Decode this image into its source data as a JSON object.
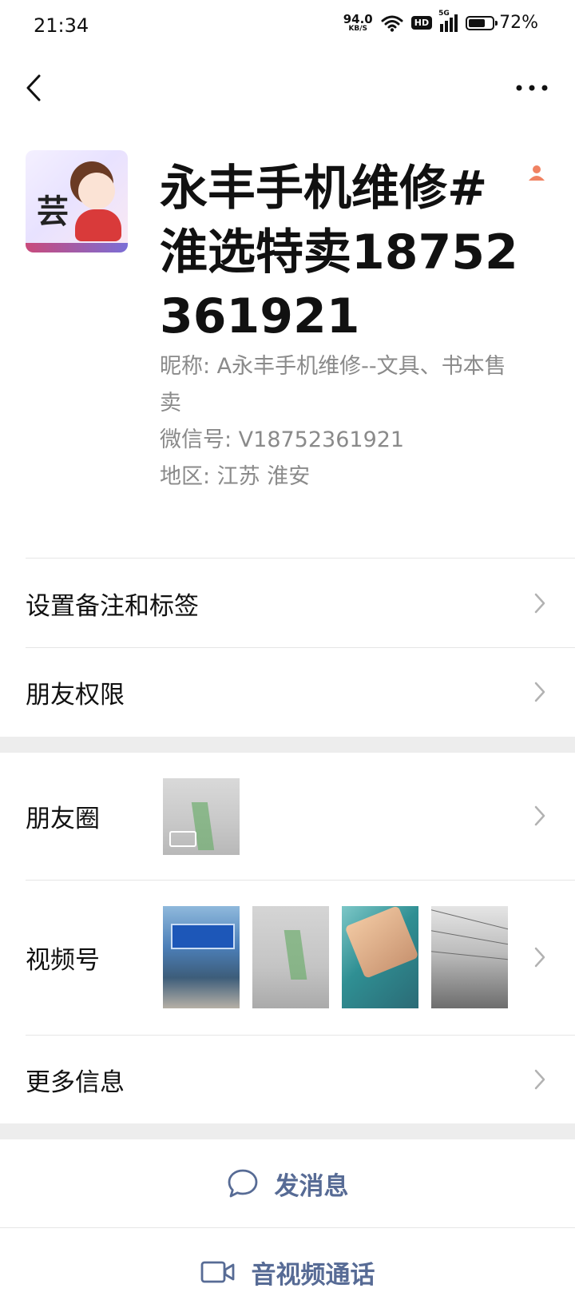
{
  "status_bar": {
    "time": "21:34",
    "net_speed_value": "94.0",
    "net_speed_unit": "KB/S",
    "hd_badge": "HD",
    "signal_tag": "5G",
    "battery_percent": "72%",
    "battery_level": 0.72
  },
  "profile": {
    "display_name": "永丰手机维修#淮选特卖18752361921",
    "avatar_char": "芸",
    "nickname": "昵称: A永丰手机维修--文具、书本售卖",
    "wechat_id": "微信号: V18752361921",
    "region": "地区: 江苏 淮安"
  },
  "menu": {
    "remark_tags": "设置备注和标签",
    "friend_permissions": "朋友权限",
    "moments": "朋友圈",
    "channels": "视频号",
    "more_info": "更多信息"
  },
  "actions": {
    "send_message": "发消息",
    "av_call": "音视频通话"
  },
  "colors": {
    "accent": "#576b95",
    "gap": "#ededed",
    "meta_text": "#8a8a8a",
    "person_icon": "#f08262"
  }
}
